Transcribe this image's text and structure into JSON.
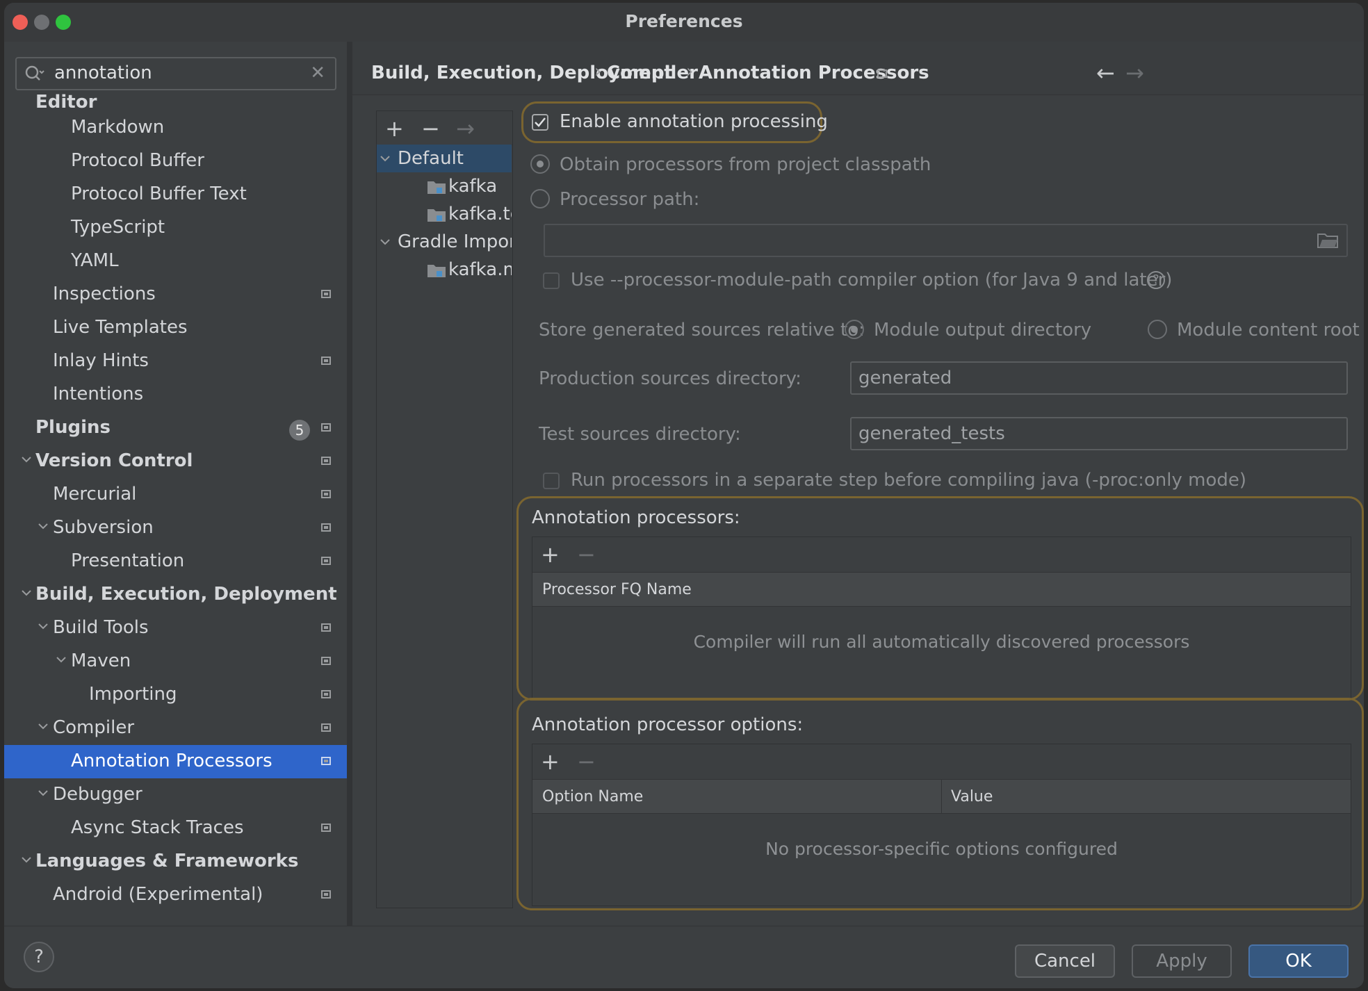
{
  "window": {
    "title": "Preferences"
  },
  "search": {
    "value": "annotation"
  },
  "sidebar": {
    "items": [
      {
        "label": "Editor"
      },
      {
        "label": "Markdown"
      },
      {
        "label": "Protocol Buffer"
      },
      {
        "label": "Protocol Buffer Text"
      },
      {
        "label": "TypeScript"
      },
      {
        "label": "YAML"
      },
      {
        "label": "Inspections"
      },
      {
        "label": "Live Templates"
      },
      {
        "label": "Inlay Hints"
      },
      {
        "label": "Intentions"
      },
      {
        "label": "Plugins",
        "badge": "5"
      },
      {
        "label": "Version Control"
      },
      {
        "label": "Mercurial"
      },
      {
        "label": "Subversion"
      },
      {
        "label": "Presentation"
      },
      {
        "label": "Build, Execution, Deployment"
      },
      {
        "label": "Build Tools"
      },
      {
        "label": "Maven"
      },
      {
        "label": "Importing"
      },
      {
        "label": "Compiler"
      },
      {
        "label": "Annotation Processors"
      },
      {
        "label": "Debugger"
      },
      {
        "label": "Async Stack Traces"
      },
      {
        "label": "Languages & Frameworks"
      },
      {
        "label": "Android (Experimental)"
      }
    ]
  },
  "breadcrumb": [
    "Build, Execution, Deployment",
    "Compiler",
    "Annotation Processors"
  ],
  "profiles": {
    "items": [
      {
        "label": "Default"
      },
      {
        "label": "kafka"
      },
      {
        "label": "kafka.te"
      },
      {
        "label": "Gradle Impor"
      },
      {
        "label": "kafka.m"
      }
    ]
  },
  "options": {
    "enable": "Enable annotation processing",
    "obtain": "Obtain processors from project classpath",
    "processor_path": "Processor path:",
    "module_path": "Use --processor-module-path compiler option (for Java 9 and later)",
    "store_label": "Store generated sources relative to:",
    "module_output": "Module output directory",
    "module_content": "Module content root",
    "prod_label": "Production sources directory:",
    "prod_value": "generated",
    "test_label": "Test sources directory:",
    "test_value": "generated_tests",
    "run_separate": "Run processors in a separate step before compiling java (-proc:only mode)"
  },
  "processors": {
    "title": "Annotation processors:",
    "column": "Processor FQ Name",
    "empty": "Compiler will run all automatically discovered processors"
  },
  "processor_options": {
    "title": "Annotation processor options:",
    "col_name": "Option Name",
    "col_value": "Value",
    "empty": "No processor-specific options configured"
  },
  "footer": {
    "cancel": "Cancel",
    "apply": "Apply",
    "ok": "OK",
    "help": "?"
  },
  "colors": {
    "accent": "#2f65ca",
    "highlight": "#7a6430",
    "background": "#3c3f41"
  }
}
